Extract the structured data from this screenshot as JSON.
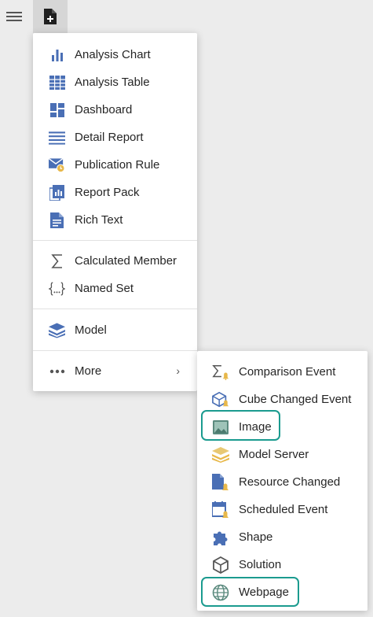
{
  "toolbar": {
    "menu_icon": "hamburger-icon",
    "new_icon": "new-document-icon"
  },
  "main_menu": {
    "items": [
      {
        "label": "Analysis Chart",
        "icon": "bar-chart-icon"
      },
      {
        "label": "Analysis Table",
        "icon": "table-grid-icon"
      },
      {
        "label": "Dashboard",
        "icon": "dashboard-icon"
      },
      {
        "label": "Detail Report",
        "icon": "list-lines-icon"
      },
      {
        "label": "Publication Rule",
        "icon": "mail-clock-icon"
      },
      {
        "label": "Report Pack",
        "icon": "report-pack-icon"
      },
      {
        "label": "Rich Text",
        "icon": "document-text-icon"
      },
      {
        "label": "Calculated Member",
        "icon": "sigma-icon"
      },
      {
        "label": "Named Set",
        "icon": "braces-icon"
      },
      {
        "label": "Model",
        "icon": "layers-icon"
      },
      {
        "label": "More",
        "icon": "ellipsis-icon",
        "chevron": "›"
      }
    ]
  },
  "sub_menu": {
    "items": [
      {
        "label": "Comparison Event",
        "icon": "sigma-bell-icon"
      },
      {
        "label": "Cube Changed Event",
        "icon": "cube-bell-icon"
      },
      {
        "label": "Image",
        "icon": "image-icon"
      },
      {
        "label": "Model Server",
        "icon": "model-server-icon"
      },
      {
        "label": "Resource Changed",
        "icon": "resource-bell-icon"
      },
      {
        "label": "Scheduled Event",
        "icon": "calendar-bell-icon"
      },
      {
        "label": "Shape",
        "icon": "puzzle-icon"
      },
      {
        "label": "Solution",
        "icon": "box-icon"
      },
      {
        "label": "Webpage",
        "icon": "globe-icon"
      }
    ]
  },
  "colors": {
    "icon_blue": "#4a6fb5",
    "bell_gold": "#e8b84a",
    "highlight": "#1b9b8f",
    "background": "#ececec"
  }
}
